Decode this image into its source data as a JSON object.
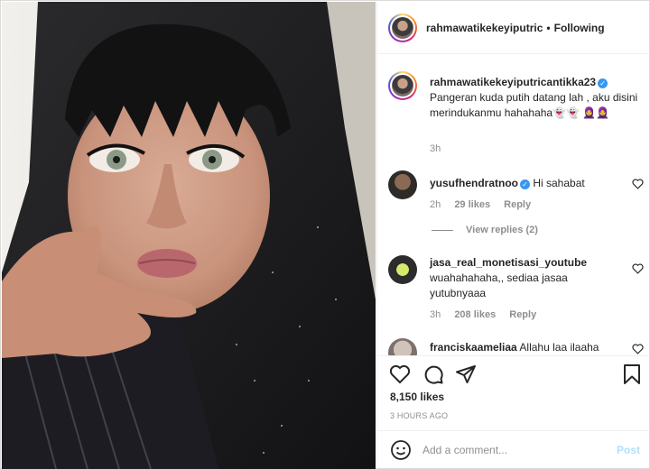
{
  "header": {
    "username": "rahmawatikekeyiputric",
    "separator": "•",
    "follow_status": "Following"
  },
  "caption": {
    "username": "rahmawatikekeyiputricantikka23",
    "text": "Pangeran kuda putih datang lah , aku disini merindukanmu hahahaha👻👻 🧕🧕",
    "time": "3h"
  },
  "comments": [
    {
      "username": "yusufhendratnoo",
      "verified": true,
      "text": "Hi sahabat",
      "time": "2h",
      "likes": "29 likes",
      "reply": "Reply"
    },
    {
      "username": "jasa_real_monetisasi_youtube",
      "verified": false,
      "text": "wuahahahaha,, sediaa jasaa yutubnyaaa",
      "time": "3h",
      "likes": "208 likes",
      "reply": "Reply"
    },
    {
      "username": "franciskaameliaa",
      "verified": false,
      "text": "Allahu laa ilaaha"
    }
  ],
  "view_replies": "View replies (2)",
  "post": {
    "likes": "8,150 likes",
    "timestamp": "3 HOURS AGO"
  },
  "add_comment": {
    "placeholder": "Add a comment...",
    "post_label": "Post"
  },
  "colors": {
    "verified": "#3897f0",
    "post_disabled": "#b2dffc",
    "muted": "#8e8e8e",
    "text": "#262626"
  },
  "icons": [
    "heart-icon",
    "comment-icon",
    "share-icon",
    "bookmark-icon",
    "smile-icon",
    "verified-icon"
  ]
}
